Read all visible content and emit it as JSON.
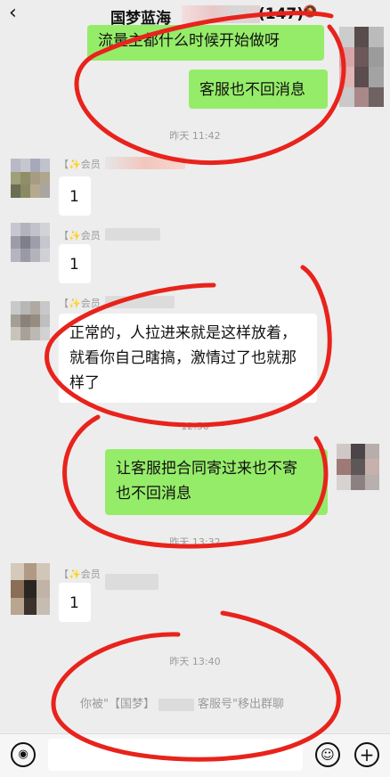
{
  "header": {
    "back_icon": "‹",
    "title": "国梦蓝海",
    "member_count": "(147)",
    "mute_icon": "bell-mute-icon"
  },
  "messages": {
    "partial_top": "流量主都什么时候开始做呀",
    "m1": "客服也不回消息",
    "ts1": "昨天 11:42",
    "sender1_prefix": "【✨会员",
    "reply1": "1",
    "sender2_prefix": "【✨会员",
    "reply2": "1",
    "sender3_prefix": "【✨会员",
    "m3_line1": "正常的，人拉进来就是这样放着，",
    "m3_line2": "就看你自己瞎搞，激情过了也就那",
    "m3_line3": "样了",
    "ts2": "12:50",
    "m4_line1": "让客服把合同寄过来也不寄",
    "m4_line2": "也不回消息",
    "ts3": "昨天 13:32",
    "sender4_prefix": "【✨会员",
    "reply4": "1",
    "ts4": "昨天 13:40",
    "system_left": "你被\"【国梦】",
    "system_right": "客服号\"移出群聊"
  },
  "toolbar": {
    "voice_icon": "voice-icon",
    "emoji_icon": "emoji-icon",
    "plus_icon": "plus-icon"
  },
  "colors": {
    "bubble_green": "#95ec69",
    "scribble_red": "#e8231c",
    "background": "#ededed"
  }
}
